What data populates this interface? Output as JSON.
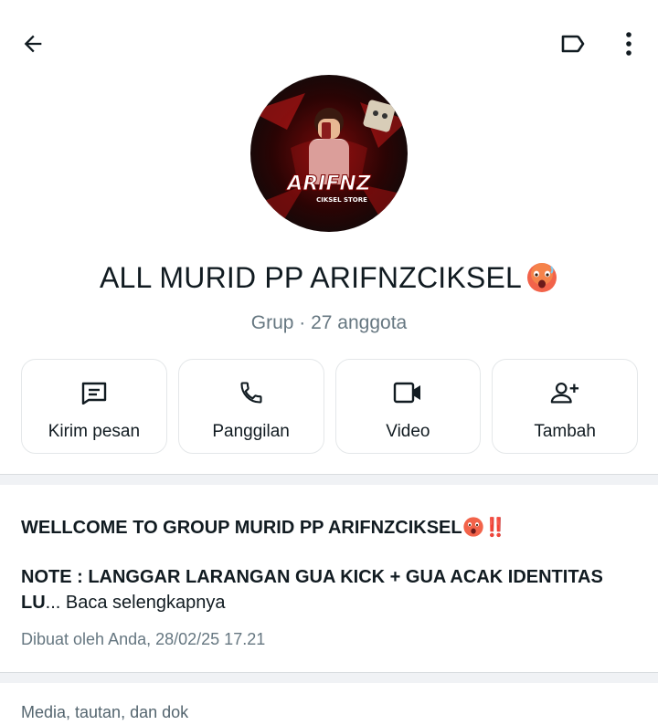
{
  "header": {
    "back_icon": "arrow-left-icon",
    "label_icon": "label-tag-icon",
    "menu_icon": "more-vertical-icon"
  },
  "profile": {
    "avatar_logo_text": "ARIFNZ",
    "avatar_logo_sub": "CIKSEL STORE",
    "name": "ALL MURID PP ARIFNZCIKSEL",
    "name_emoji": "hot-face-emoji",
    "subtitle": "Grup · 27 anggota"
  },
  "actions": [
    {
      "label": "Kirim pesan",
      "icon": "message-icon"
    },
    {
      "label": "Panggilan",
      "icon": "phone-icon"
    },
    {
      "label": "Video",
      "icon": "video-icon"
    },
    {
      "label": "Tambah",
      "icon": "add-person-icon"
    }
  ],
  "description": {
    "line1": "WELLCOME TO GROUP MURID PP ARIFNZCIKSEL",
    "line1_suffix": "‼️",
    "note_bold": "NOTE : LANGGAR LARANGAN GUA KICK + GUA ACAK IDENTITAS LU",
    "note_ellipsis": "...",
    "read_more": " Baca selengkapnya",
    "created": "Dibuat oleh Anda, 28/02/25 17.21"
  },
  "media": {
    "title": "Media, tautan, dan dok"
  },
  "colors": {
    "text_primary": "#111b21",
    "text_secondary": "#667781",
    "divider": "#f0f2f5",
    "emoji_red": "#e53935"
  }
}
